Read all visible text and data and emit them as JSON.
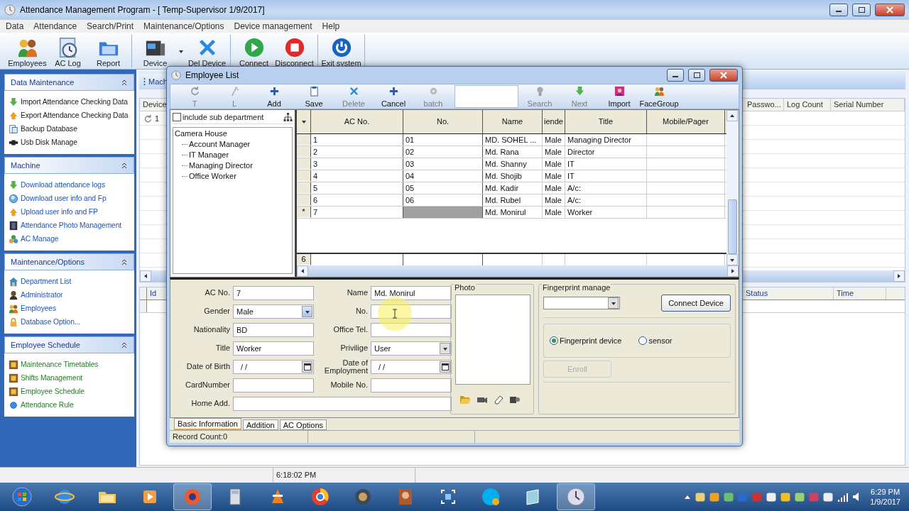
{
  "window": {
    "title": "Attendance Management Program - [ Temp-Supervisor 1/9/2017]"
  },
  "menu": [
    "Data",
    "Attendance",
    "Search/Print",
    "Maintenance/Options",
    "Device management",
    "Help"
  ],
  "toolbar": [
    [
      {
        "label": "Employees",
        "kind": "people"
      },
      {
        "label": "AC Log",
        "kind": "clock"
      },
      {
        "label": "Report",
        "kind": "folder"
      }
    ],
    [
      {
        "label": "Device",
        "kind": "terminal",
        "dropdown": true
      },
      {
        "label": "Del Device",
        "kind": "cross"
      }
    ],
    [
      {
        "label": "Connect",
        "kind": "play"
      },
      {
        "label": "Disconnect",
        "kind": "stop"
      }
    ],
    [
      {
        "label": "Exit system",
        "kind": "power"
      }
    ]
  ],
  "sidebar": [
    {
      "title": "Data Maintenance",
      "expanded": true,
      "kind": "data",
      "items": [
        {
          "label": "Import Attendance Checking Data",
          "kind": "arrow-down"
        },
        {
          "label": "Export Attendance Checking Data",
          "kind": "arrow-up"
        },
        {
          "label": "Backup Database",
          "kind": "document"
        },
        {
          "label": "Usb Disk Manage",
          "kind": "usb"
        }
      ]
    },
    {
      "title": "Machine",
      "expanded": true,
      "kind": "device",
      "items": [
        {
          "label": "Download attendance logs",
          "kind": "arrow-down"
        },
        {
          "label": "Download user info and Fp",
          "kind": "globe"
        },
        {
          "label": "Upload user info and FP",
          "kind": "arrow-up"
        },
        {
          "label": "Attendance Photo Management",
          "kind": "film"
        },
        {
          "label": "AC Manage",
          "kind": "circles"
        }
      ]
    },
    {
      "title": "Maintenance/Options",
      "expanded": true,
      "kind": "device",
      "items": [
        {
          "label": "Department List",
          "kind": "house"
        },
        {
          "label": "Administrator",
          "kind": "person"
        },
        {
          "label": "Employees",
          "kind": "people"
        },
        {
          "label": "Database Option...",
          "kind": "lock"
        }
      ]
    },
    {
      "title": "Employee Schedule",
      "expanded": true,
      "kind": "schedule",
      "items": [
        {
          "label": "Maintenance Timetables",
          "kind": "calendar"
        },
        {
          "label": "Shifts Management",
          "kind": "calendar"
        },
        {
          "label": "Employee Schedule",
          "kind": "calendar"
        },
        {
          "label": "Attendance Rule",
          "kind": "dot"
        }
      ]
    }
  ],
  "main_tab": "Mach",
  "device_table": {
    "columns_left": [
      "Device"
    ],
    "columns_right": [
      "Passwo...",
      "Log Count",
      "Serial Number"
    ],
    "rows": [
      {
        "device": "1"
      }
    ]
  },
  "log_table": {
    "columns_left": [
      "Id"
    ],
    "columns_right": [
      "Status",
      "Time"
    ]
  },
  "status_bar": [
    "6:18:02 PM"
  ],
  "dialog": {
    "title": "Employee List",
    "toolbar": [
      {
        "label": "T",
        "kind": "refresh",
        "disabled": true
      },
      {
        "label": "L",
        "kind": "wand",
        "disabled": true
      },
      {
        "label": "Add",
        "kind": "plus",
        "disabled": false
      },
      {
        "label": "Save",
        "kind": "clipboard",
        "disabled": false
      },
      {
        "label": "Delete",
        "kind": "cross",
        "disabled": true
      },
      {
        "label": "Cancel",
        "kind": "plus",
        "disabled": false
      },
      {
        "label": "batch",
        "kind": "gear",
        "disabled": true
      },
      {
        "kind": "field"
      },
      {
        "label": "Search",
        "kind": "bulb",
        "disabled": true
      },
      {
        "label": "Next",
        "kind": "arrow-down",
        "disabled": true
      },
      {
        "label": "Import",
        "kind": "image",
        "disabled": false
      },
      {
        "label": "FaceGroup",
        "kind": "people",
        "disabled": false
      }
    ],
    "include_sub": {
      "label": "include sub department",
      "checked": false
    },
    "tree": {
      "label": "Camera House",
      "children": [
        {
          "label": "Account Manager"
        },
        {
          "label": "IT Manager"
        },
        {
          "label": "Managing Director"
        },
        {
          "label": "Office Worker"
        }
      ]
    },
    "grid": {
      "columns": [
        "AC No.",
        "No.",
        "Name",
        "iende",
        "Title",
        "Mobile/Pager"
      ],
      "rows": [
        {
          "cells": [
            "1",
            "01",
            "MD. SOHEL ...",
            "Male",
            "Managing Director",
            ""
          ]
        },
        {
          "cells": [
            "2",
            "02",
            "Md. Rana",
            "Male",
            "Director",
            ""
          ]
        },
        {
          "cells": [
            "3",
            "03",
            "Md. Shanny",
            "Male",
            "IT",
            ""
          ]
        },
        {
          "cells": [
            "4",
            "04",
            "Md. Shojib",
            "Male",
            "IT",
            ""
          ]
        },
        {
          "cells": [
            "5",
            "05",
            "Md. Kadir",
            "Male",
            "A/c:",
            ""
          ]
        },
        {
          "cells": [
            "6",
            "06",
            "Md. Rubel",
            "Male",
            "A/c:",
            ""
          ]
        },
        {
          "marker": "*",
          "cells": [
            "7",
            {
              "selected": true
            },
            "Md. Monirul",
            "Male",
            "Worker",
            ""
          ]
        }
      ],
      "footer": "6"
    },
    "form": {
      "left": [
        {
          "label": "AC No.",
          "value": "7",
          "kind": "text"
        },
        {
          "label": "Gender",
          "value": "Male",
          "kind": "combo"
        },
        {
          "label": "Nationality",
          "value": "BD",
          "kind": "text"
        },
        {
          "label": "Title",
          "value": "Worker",
          "kind": "text"
        },
        {
          "label": "Date of Birth",
          "value": "/ /",
          "kind": "date"
        },
        {
          "label": "CardNumber",
          "kind": "text"
        }
      ],
      "right": [
        {
          "label": "Name",
          "value": "Md. Monirul",
          "kind": "text"
        },
        {
          "label": "No.",
          "kind": "text"
        },
        {
          "label": "Office Tel.",
          "kind": "text"
        },
        {
          "label": "Privilige",
          "value": "User",
          "kind": "select"
        },
        {
          "label": "Date of Employment",
          "value": "/ /",
          "kind": "date"
        },
        {
          "label": "Mobile No.",
          "kind": "text"
        }
      ],
      "home": {
        "label": "Home Add."
      },
      "photo": {
        "title": "Photo"
      },
      "fingerprint": {
        "title": "Fingerprint manage",
        "connect": "Connect Device",
        "options": [
          {
            "label": "Fingerprint device",
            "selected": true
          },
          {
            "label": "sensor",
            "selected": false
          }
        ],
        "enroll": {
          "label": "Enroll",
          "disabled": true
        }
      }
    },
    "tabs": [
      {
        "label": "Basic Information",
        "selected": true
      },
      {
        "label": "Addition",
        "selected": false
      },
      {
        "label": "AC Options",
        "selected": false
      }
    ],
    "status": "Record Count:0"
  },
  "taskbar": {
    "time": "6:29 PM",
    "date": "1/9/2017"
  }
}
